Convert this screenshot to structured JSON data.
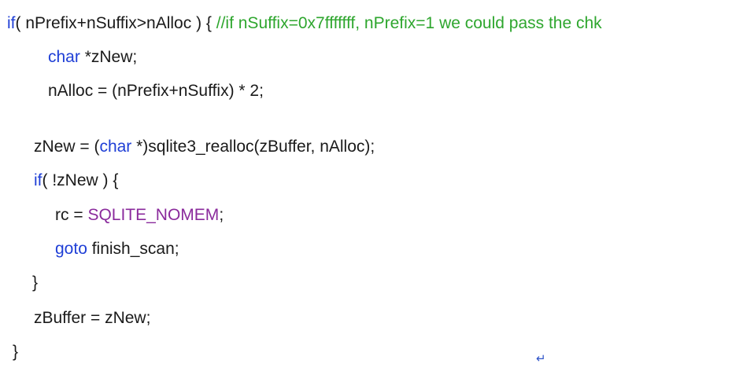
{
  "code": {
    "line1": {
      "kw_if": "if",
      "text": "( nPrefix+nSuffix>nAlloc ) { ",
      "comment": "//if nSuffix=0x7fffffff, nPrefix=1 we could pass the chk"
    },
    "line2": {
      "kw_char": "char",
      "text": " *zNew;"
    },
    "line3": {
      "text": "nAlloc = (nPrefix+nSuffix) * 2;"
    },
    "line4": {
      "text_a": "zNew = (",
      "kw_char": "char",
      "text_b": " *)sqlite3_realloc(zBuffer, nAlloc);"
    },
    "line5": {
      "kw_if": "if",
      "text": "( !zNew ) {"
    },
    "line6": {
      "text_a": "rc = ",
      "macro": "SQLITE_NOMEM",
      "text_b": ";"
    },
    "line7": {
      "kw_goto": "goto",
      "text": " finish_scan;"
    },
    "line8": {
      "text": "}"
    },
    "line9": {
      "text": "zBuffer = zNew;"
    },
    "line10": {
      "text": "}"
    }
  },
  "paragraph_mark": "↵",
  "colors": {
    "keyword": "#1f3fd6",
    "comment": "#2ea62e",
    "macro": "#8a2a9c",
    "text": "#1a1a1a"
  }
}
